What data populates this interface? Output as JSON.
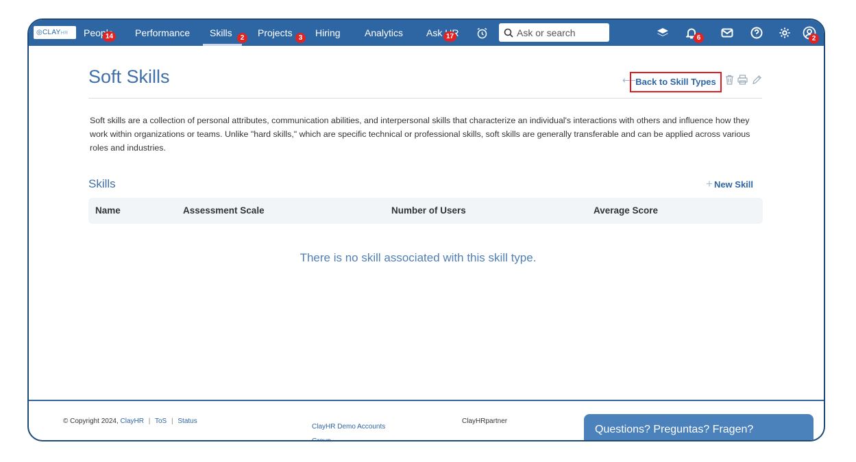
{
  "nav": {
    "logo": "CLAY",
    "logo_suffix": "HR",
    "items": [
      {
        "label": "People",
        "badge": "14"
      },
      {
        "label": "Performance"
      },
      {
        "label": "Skills",
        "badge": "2"
      },
      {
        "label": "Projects",
        "badge": "3"
      },
      {
        "label": "Hiring"
      },
      {
        "label": "Analytics"
      },
      {
        "label": "Ask HR",
        "badge": "17"
      }
    ],
    "search_placeholder": "Ask or search",
    "notifications_badge": "6",
    "profile_badge": "2",
    "icons": [
      "alarm-clock-icon",
      "layers-icon",
      "bell-icon",
      "mail-icon",
      "help-icon",
      "settings-icon",
      "user-avatar-icon"
    ]
  },
  "page": {
    "title": "Soft Skills",
    "back_link": "Back to Skill Types",
    "description": "Soft skills are a collection of personal attributes, communication abilities, and interpersonal skills that characterize an individual's interactions with others and influence how they work within organizations or teams. Unlike \"hard skills,\" which are specific technical or professional skills, soft skills are generally transferable and can be applied across various roles and industries."
  },
  "skills": {
    "section_title": "Skills",
    "new_skill": "New Skill",
    "columns": [
      "Name",
      "Assessment Scale",
      "Number of Users",
      "Average Score"
    ],
    "empty_message": "There is no skill associated with this skill type."
  },
  "footer": {
    "copyright": "© Copyright 2024,",
    "company": "ClayHR",
    "tos": "ToS",
    "status": "Status",
    "demo_accounts": "ClayHR Demo Accounts Group",
    "partner": "ClayHRpartner",
    "questions": "Questions? Preguntas? Fragen?"
  }
}
